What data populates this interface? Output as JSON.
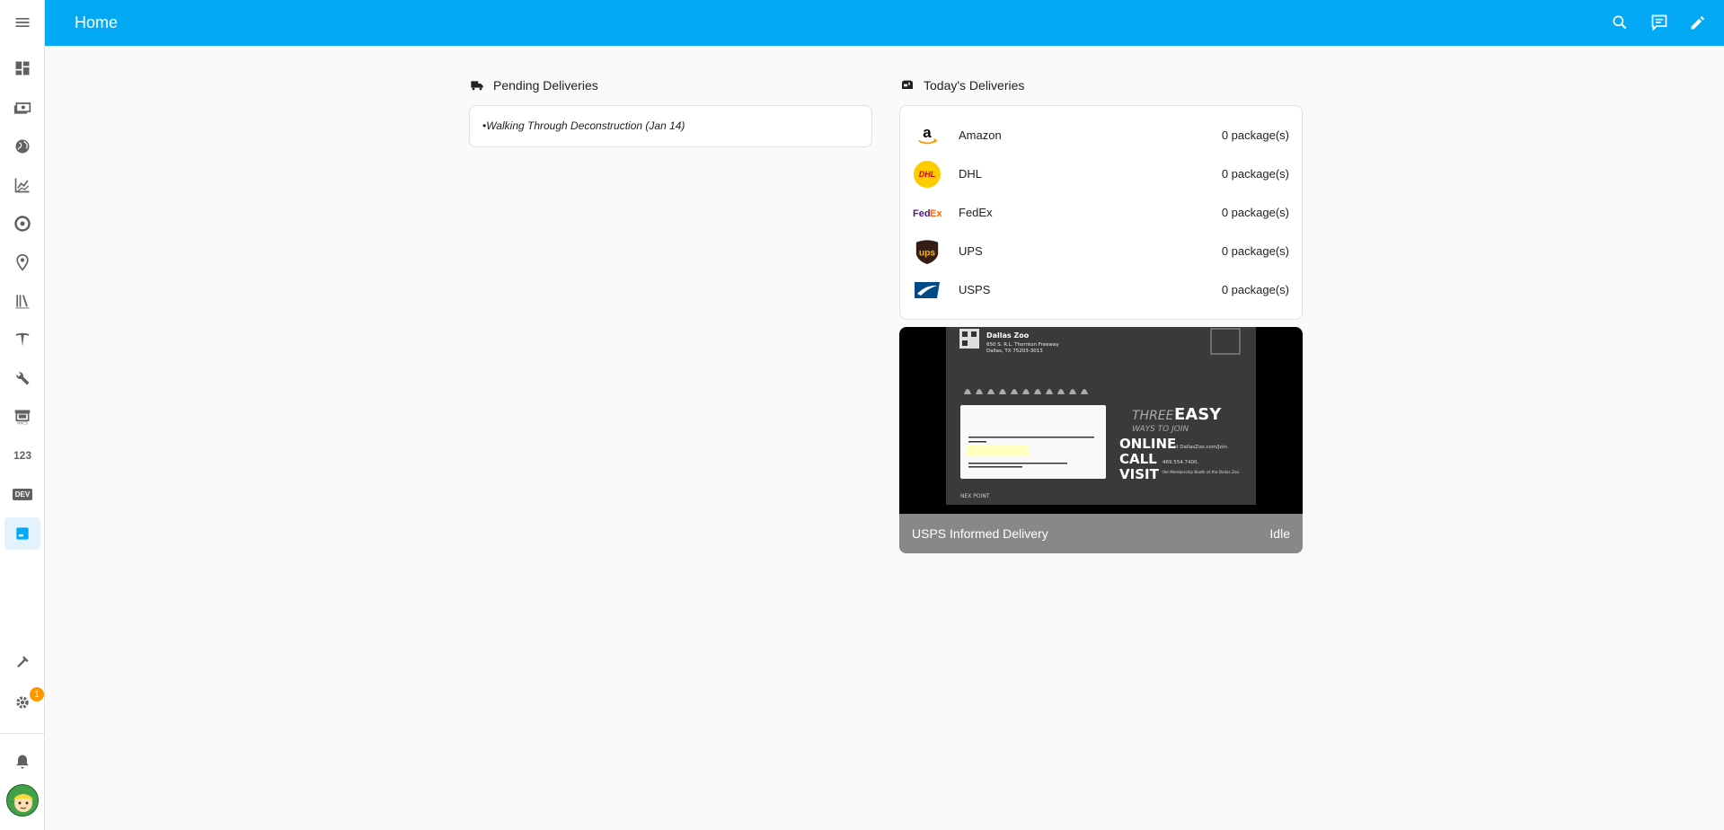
{
  "header": {
    "title": "Home"
  },
  "pending": {
    "title": "Pending Deliveries",
    "items": [
      "•Walking Through Deconstruction (Jan 14)"
    ]
  },
  "today": {
    "title": "Today's Deliveries",
    "carriers": [
      {
        "name": "Amazon",
        "count": "0 package(s)",
        "icon": "amazon-logo"
      },
      {
        "name": "DHL",
        "count": "0 package(s)",
        "icon": "dhl-logo"
      },
      {
        "name": "FedEx",
        "count": "0 package(s)",
        "icon": "fedex-logo"
      },
      {
        "name": "UPS",
        "count": "0 package(s)",
        "icon": "ups-logo"
      },
      {
        "name": "USPS",
        "count": "0 package(s)",
        "icon": "usps-logo"
      }
    ]
  },
  "mail": {
    "name": "USPS Informed Delivery",
    "state": "Idle",
    "sender": "Dallas Zoo",
    "address": [
      "650 S. R.L. Thornton Freeway",
      "Dallas, TX 75203-3013"
    ],
    "headline": [
      "THREE",
      "EASY",
      "WAYS TO JOIN"
    ],
    "options": [
      "ONLINE",
      "CALL",
      "VISIT"
    ],
    "option_details": [
      "at DallasZoo.com/Join.",
      "469.554.7400.",
      "the Membership Booth at the Dallas Zoo."
    ],
    "footer_text": "NEX POINT"
  },
  "sidebar": {
    "items": [
      "overview-icon",
      "cash-icon",
      "earth-icon",
      "chart-icon",
      "target-icon",
      "map-marker-icon",
      "library-icon",
      "tesla-icon",
      "wrench-icon",
      "store-icon",
      "numeric-icon",
      "dev-icon",
      "mailbox-icon"
    ],
    "badge": "1",
    "dev_label": "DEV",
    "numeric_label": "123"
  },
  "colors": {
    "header": "#03a9f4",
    "badge": "#ff9800",
    "accent": "#03a9f4"
  }
}
